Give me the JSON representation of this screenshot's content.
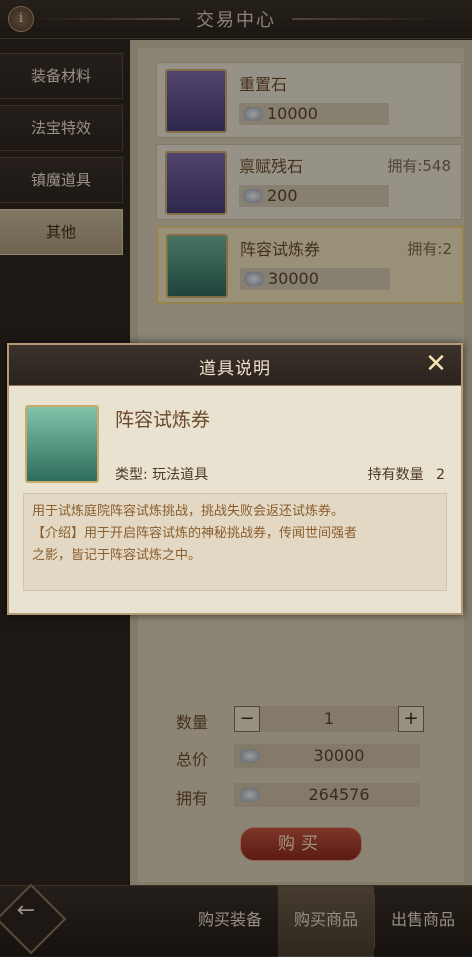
{
  "header": {
    "title": "交易中心",
    "info_icon": "info-icon"
  },
  "sidebar": {
    "items": [
      {
        "label": "装备材料",
        "active": false
      },
      {
        "label": "法宝特效",
        "active": false
      },
      {
        "label": "镇魔道具",
        "active": false
      },
      {
        "label": "其他",
        "active": true
      }
    ]
  },
  "items": [
    {
      "name": "重置石",
      "own": "",
      "price": "10000",
      "icon": "stone-icon"
    },
    {
      "name": "禀赋残石",
      "own": "拥有:548",
      "price": "200",
      "icon": "crystal-icon"
    },
    {
      "name": "阵容试炼券",
      "own": "拥有:2",
      "price": "30000",
      "icon": "ticket-icon",
      "selected": true
    }
  ],
  "buy": {
    "qty_label": "数量",
    "qty_value": "1",
    "minus": "−",
    "plus": "+",
    "total_label": "总价",
    "total_value": "30000",
    "own_label": "拥有",
    "own_value": "264576",
    "buy_button": "购买"
  },
  "bottom_tabs": [
    {
      "label": "购买装备",
      "active": false
    },
    {
      "label": "购买商品",
      "active": true
    },
    {
      "label": "出售商品",
      "active": false
    }
  ],
  "dialog": {
    "title": "道具说明",
    "close": "✕",
    "name": "阵容试炼券",
    "type": "类型: 玩法道具",
    "hold_label": "持有数量",
    "hold_value": "2",
    "desc_lines": [
      "用于试炼庭院阵容试炼挑战，挑战失败会返还试炼券。",
      "【介绍】用于开启阵容试炼的神秘挑战券，传闻世间强者",
      "之影，皆记于阵容试炼之中。"
    ]
  },
  "colors": {
    "accent": "#e8c97a",
    "buy_button": "#a63a2c",
    "panel": "#eae2d0"
  }
}
